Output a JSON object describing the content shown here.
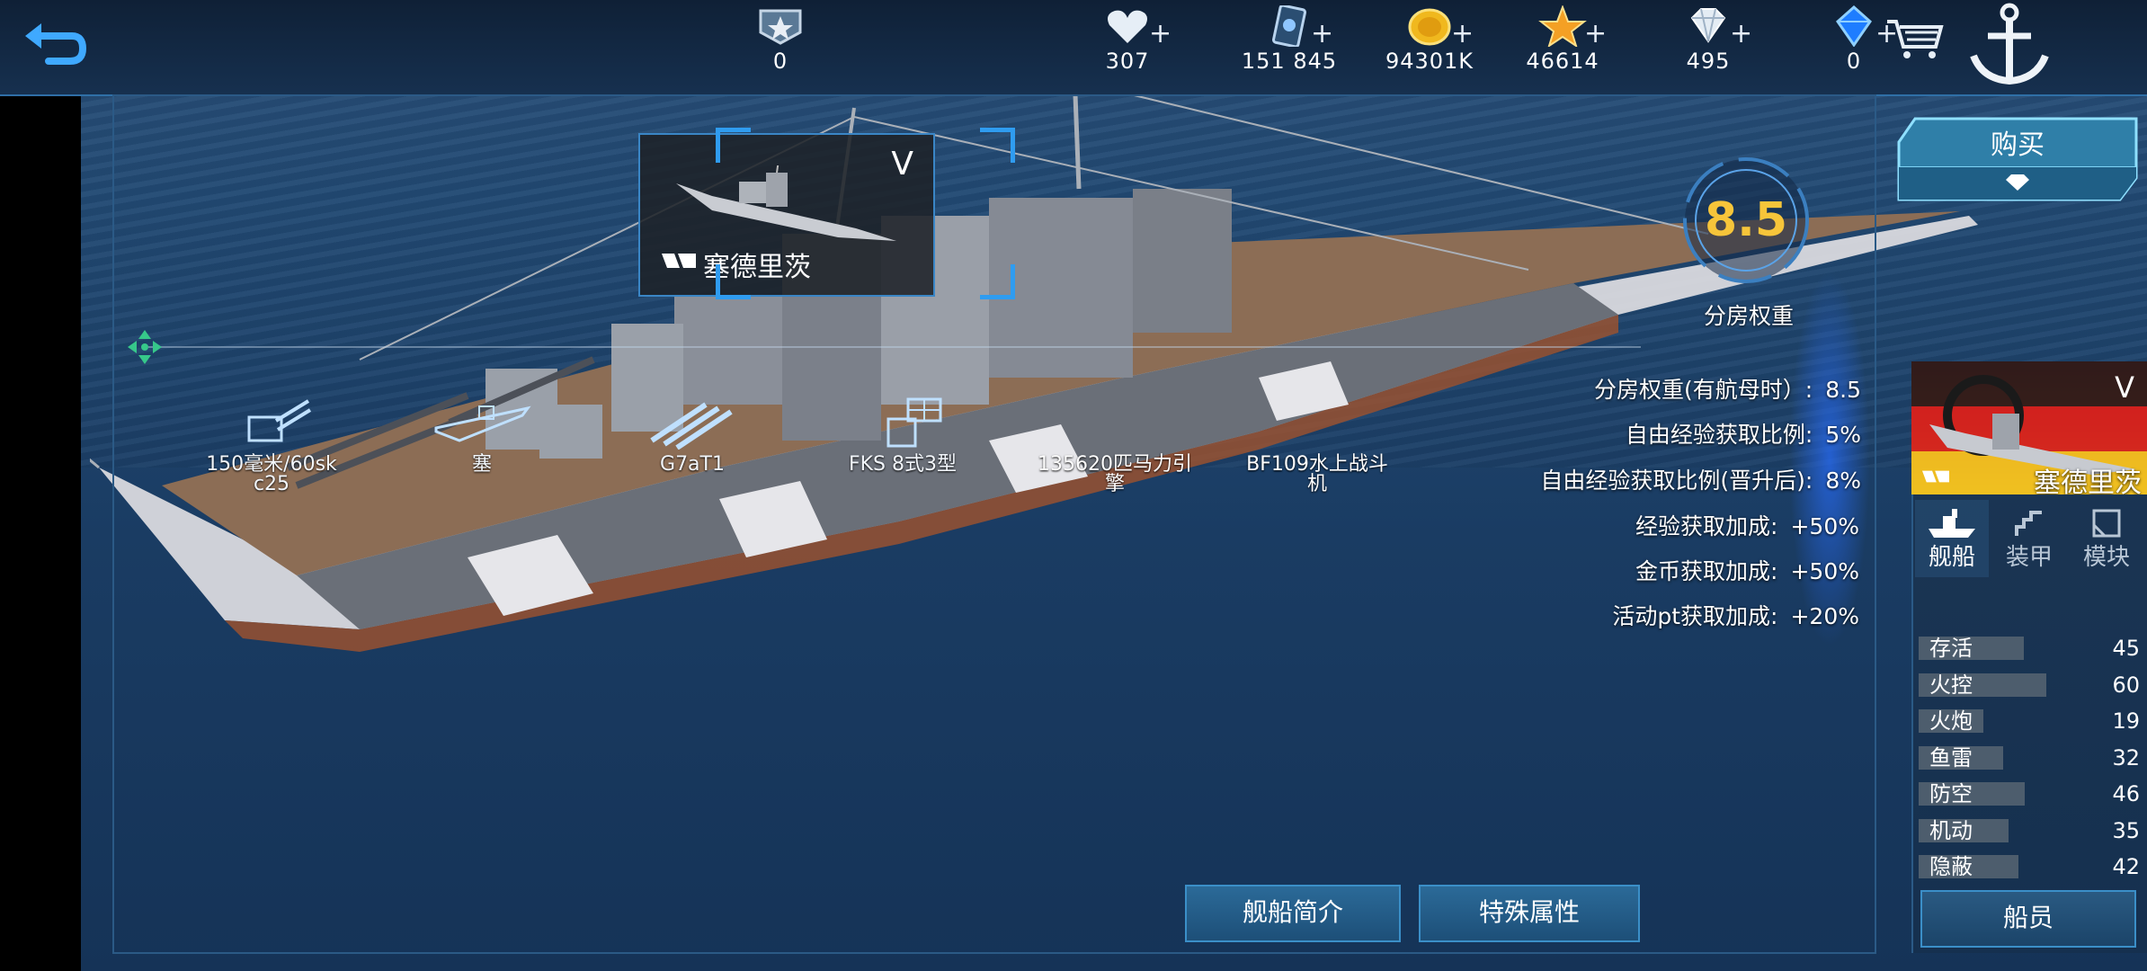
{
  "resources": [
    {
      "icon": "rank-badge-icon",
      "value": "0",
      "has_plus": false
    },
    {
      "icon": "heart-icon",
      "value": "307",
      "has_plus": true
    },
    {
      "icon": "card-icon",
      "value": "151 845",
      "has_plus": true
    },
    {
      "icon": "gold-coin-icon",
      "value": "94301K",
      "has_plus": true
    },
    {
      "icon": "star-icon",
      "value": "46614",
      "has_plus": true
    },
    {
      "icon": "diamond-icon",
      "value": "495",
      "has_plus": true
    },
    {
      "icon": "blue-gem-icon",
      "value": "0",
      "has_plus": true
    }
  ],
  "plus_sign": "+",
  "ship_card": {
    "tier": "V",
    "name": "塞德里茨"
  },
  "equipment": [
    {
      "label": "150毫米/60sk c25",
      "icon": "gun-turret-icon"
    },
    {
      "label": "塞",
      "icon": "hull-icon"
    },
    {
      "label": "G7aT1",
      "icon": "torpedo-icon"
    },
    {
      "label": "FKS 8式3型",
      "icon": "radar-icon"
    }
  ],
  "overlay_labels": {
    "engine": "135620匹马力引擎",
    "plane": "BF109水上战斗机"
  },
  "rating": {
    "value": "8.5",
    "caption": "分房权重"
  },
  "stats": [
    {
      "label": "分房权重(有航母时）:",
      "value": "8.5"
    },
    {
      "label": "自由经验获取比例:",
      "value": "5%"
    },
    {
      "label": "自由经验获取比例(晋升后):",
      "value": "8%"
    },
    {
      "label": "经验获取加成:",
      "value": "+50%"
    },
    {
      "label": "金币获取加成:",
      "value": "+50%"
    },
    {
      "label": "活动pt获取加成:",
      "value": "+20%"
    }
  ],
  "buy_button": {
    "label": "购买"
  },
  "panel": {
    "tier": "V",
    "ship_name": "塞德里茨",
    "tabs": [
      {
        "label": "舰船",
        "active": true,
        "icon": "ship-icon"
      },
      {
        "label": "装甲",
        "active": false,
        "icon": "armor-icon"
      },
      {
        "label": "模块",
        "active": false,
        "icon": "module-icon"
      }
    ],
    "attributes": [
      {
        "name": "存活",
        "value": 45
      },
      {
        "name": "火控",
        "value": 60
      },
      {
        "name": "火炮",
        "value": 19
      },
      {
        "name": "鱼雷",
        "value": 32
      },
      {
        "name": "防空",
        "value": 46
      },
      {
        "name": "机动",
        "value": 35
      },
      {
        "name": "隐蔽",
        "value": 42
      }
    ],
    "crew_button": "船员"
  },
  "bottom_buttons": {
    "intro": "舰船简介",
    "special": "特殊属性"
  },
  "colors": {
    "accent_gold": "#f7c53a",
    "frame_blue": "#2f9cf0",
    "button_blue": "#2b6a98"
  }
}
